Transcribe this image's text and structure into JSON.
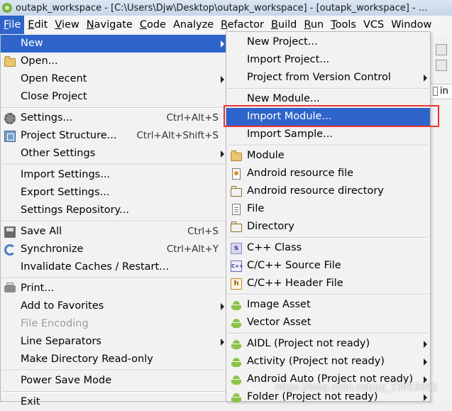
{
  "window": {
    "title": "outapk_workspace - [C:\\Users\\Djw\\Desktop\\outapk_workspace] - [outapk_workspace] - ..."
  },
  "menubar": {
    "items": [
      {
        "mnemonic": "F",
        "rest": "ile"
      },
      {
        "mnemonic": "E",
        "rest": "dit"
      },
      {
        "mnemonic": "V",
        "rest": "iew"
      },
      {
        "mnemonic": "N",
        "rest": "avigate"
      },
      {
        "mnemonic": "C",
        "rest": "ode"
      },
      {
        "mnemonic": "",
        "rest": "Analyze"
      },
      {
        "mnemonic": "R",
        "rest": "efactor"
      },
      {
        "mnemonic": "B",
        "rest": "uild"
      },
      {
        "mnemonic": "R",
        "rest": "un"
      },
      {
        "mnemonic": "T",
        "rest": "ools"
      },
      {
        "mnemonic": "",
        "rest": "VCS"
      },
      {
        "mnemonic": "",
        "rest": "Window"
      }
    ]
  },
  "file_menu": {
    "new": "New",
    "open": "Open...",
    "open_recent": "Open Recent",
    "close_project": "Close Project",
    "settings": "Settings...",
    "settings_sc": "Ctrl+Alt+S",
    "project_structure": "Project Structure...",
    "project_structure_sc": "Ctrl+Alt+Shift+S",
    "other_settings": "Other Settings",
    "import_settings": "Import Settings...",
    "export_settings": "Export Settings...",
    "settings_repository": "Settings Repository...",
    "save_all": "Save All",
    "save_all_sc": "Ctrl+S",
    "synchronize": "Synchronize",
    "synchronize_sc": "Ctrl+Alt+Y",
    "invalidate_caches": "Invalidate Caches / Restart...",
    "print": "Print...",
    "add_to_favorites": "Add to Favorites",
    "file_encoding": "File Encoding",
    "line_separators": "Line Separators",
    "make_directory_read_only": "Make Directory Read-only",
    "power_save_mode": "Power Save Mode",
    "exit": "Exit"
  },
  "new_menu": {
    "new_project": "New Project...",
    "import_project": "Import Project...",
    "project_from_vcs": "Project from Version Control",
    "new_module": "New Module...",
    "import_module": "Import Module...",
    "import_sample": "Import Sample...",
    "module": "Module",
    "android_resource_file": "Android resource file",
    "android_resource_directory": "Android resource directory",
    "file": "File",
    "directory": "Directory",
    "cpp_class": "C++ Class",
    "cpp_source_file": "C/C++ Source File",
    "cpp_header_file": "C/C++ Header File",
    "image_asset": "Image Asset",
    "vector_asset": "Vector Asset",
    "aidl": "AIDL (Project not ready)",
    "activity": "Activity (Project not ready)",
    "android_auto": "Android Auto (Project not ready)",
    "folder": "Folder (Project not ready)"
  },
  "side_tab": {
    "label": "in"
  },
  "watermark": "https://blog.csdn.net/qq_33953682",
  "colors": {
    "highlight": "#2f65ca",
    "annotation_box": "#e33333"
  }
}
